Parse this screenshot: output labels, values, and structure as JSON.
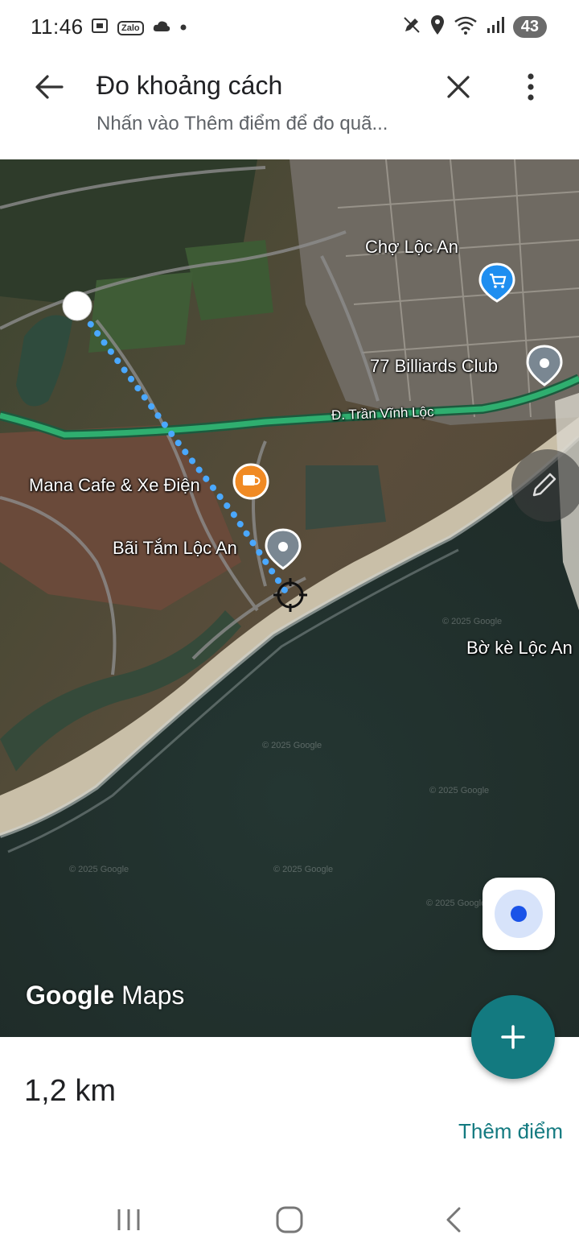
{
  "status_bar": {
    "time": "11:46",
    "zalo_label": "Zalo",
    "battery": "43",
    "icons": [
      "screenshot-icon",
      "zalo-icon",
      "cloud-icon",
      "dot-icon",
      "pen-icon",
      "location-icon",
      "wifi-icon",
      "signal-icon"
    ]
  },
  "header": {
    "title": "Đo khoảng cách",
    "subtitle": "Nhấn vào Thêm điểm để đo quã..."
  },
  "map": {
    "labels": {
      "cho_loc_an": "Chợ Lộc An",
      "billiards": "77 Billiards Club",
      "road": "Đ. Trần Vĩnh Lộc",
      "mana_cafe": "Mana Cafe & Xe Điện",
      "bai_tam": "Bãi Tắm Lộc An",
      "bo_ke": "Bờ kè Lộc An"
    },
    "watermark": "© 2025 Google",
    "logo_google": "Google",
    "logo_maps": "Maps",
    "colors": {
      "route": "#4aa8ff",
      "road": "#2fae6f",
      "sea": "#26332f",
      "accent": "#137a80"
    }
  },
  "panel": {
    "distance": "1,2 km",
    "add_point": "Thêm điểm"
  }
}
